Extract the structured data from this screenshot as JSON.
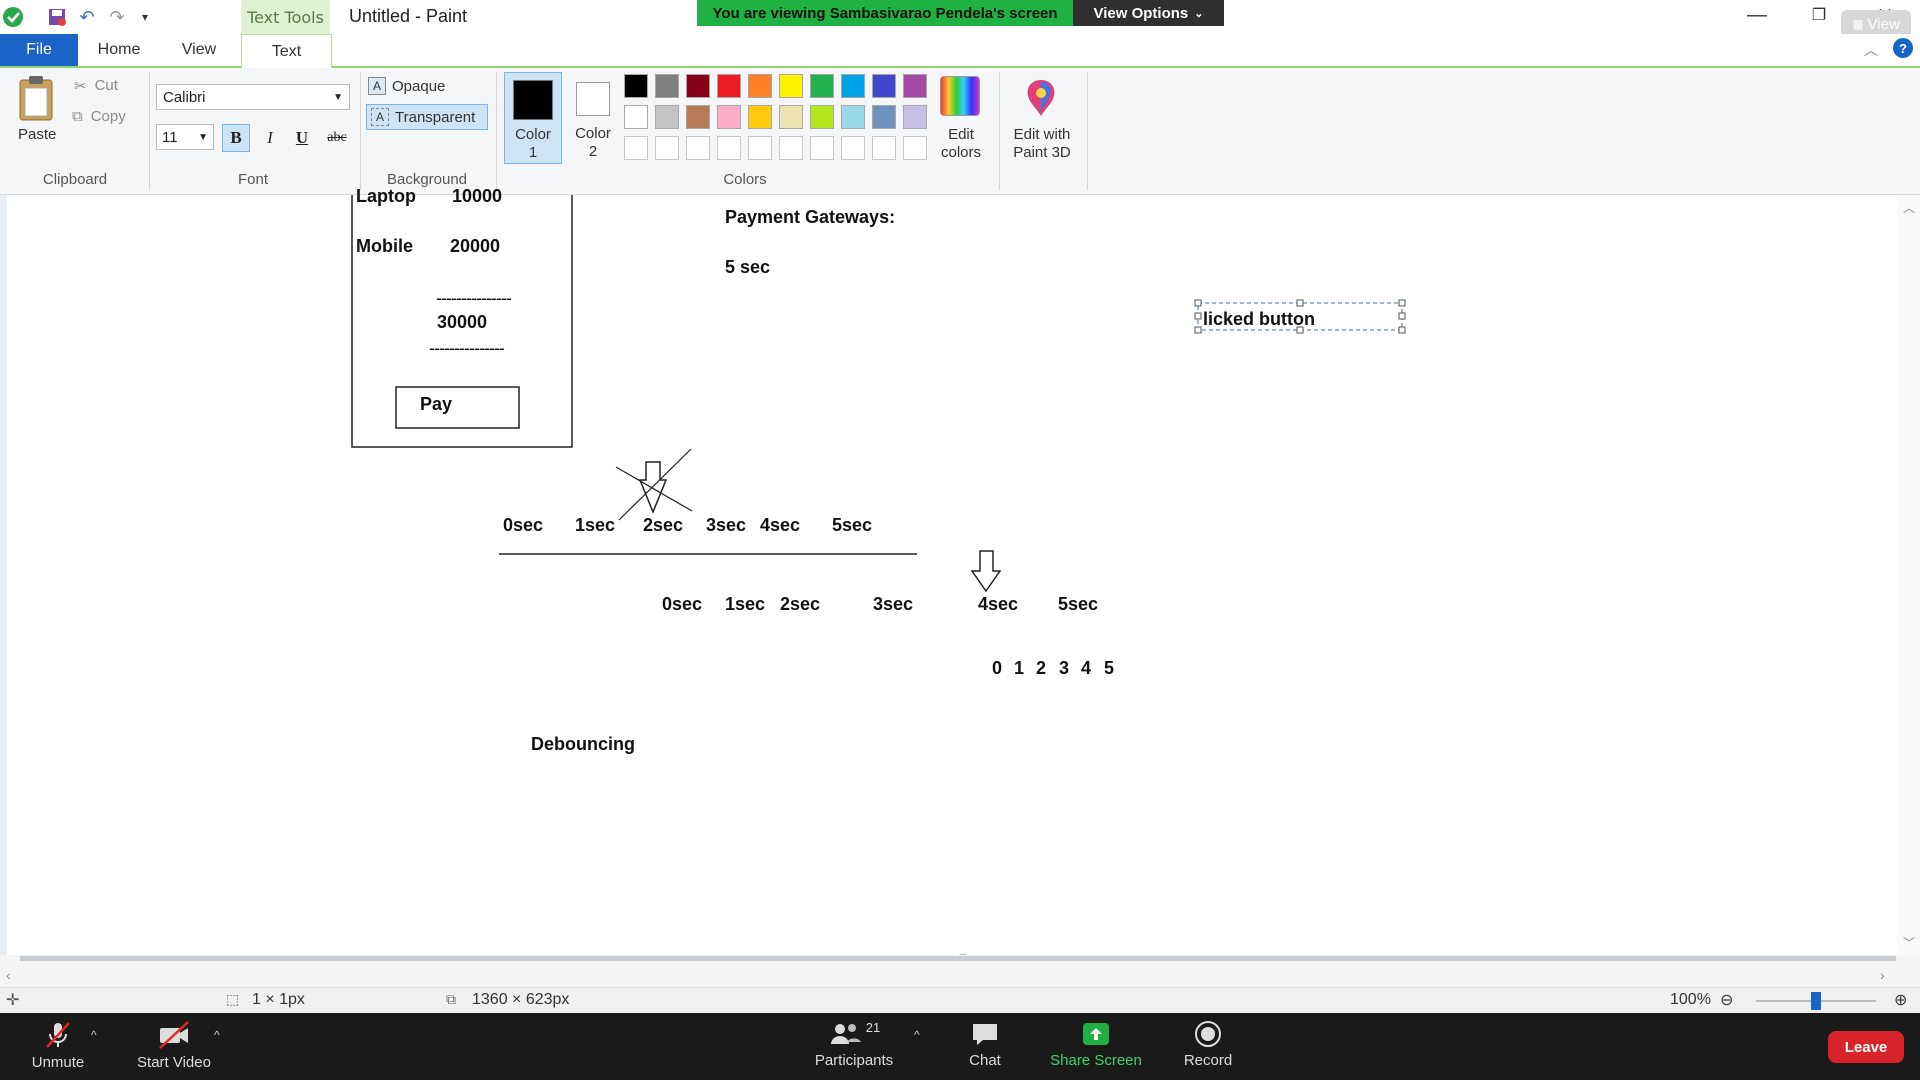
{
  "titlebar": {
    "context_tab": "Text Tools",
    "window_title": "Untitled - Paint",
    "share_banner": "You are viewing Sambasivarao Pendela's screen",
    "view_options": "View Options",
    "view_pill": "View"
  },
  "tabs": {
    "file": "File",
    "home": "Home",
    "view": "View",
    "text": "Text"
  },
  "ribbon": {
    "clipboard": {
      "paste": "Paste",
      "cut": "Cut",
      "copy": "Copy",
      "group": "Clipboard"
    },
    "font": {
      "family": "Calibri",
      "size": "11",
      "bold": "B",
      "italic": "I",
      "underline": "U",
      "strike": "abc",
      "group": "Font"
    },
    "background": {
      "opaque": "Opaque",
      "transparent": "Transparent",
      "group": "Background"
    },
    "colors": {
      "color1_label1": "Color",
      "color1_label2": "1",
      "color2_label1": "Color",
      "color2_label2": "2",
      "edit_colors_1": "Edit",
      "edit_colors_2": "colors",
      "edit_paint3d_1": "Edit with",
      "edit_paint3d_2": "Paint 3D",
      "group": "Colors",
      "color1": "#000000",
      "color2": "#ffffff",
      "row1": [
        "#000000",
        "#7f7f7f",
        "#880015",
        "#ed1c24",
        "#ff7f27",
        "#fff200",
        "#22b14c",
        "#00a2e8",
        "#3f48cc",
        "#a349a4"
      ],
      "row2": [
        "#ffffff",
        "#c3c3c3",
        "#b97a57",
        "#ffaec9",
        "#ffc90e",
        "#efe4b0",
        "#b5e61d",
        "#99d9ea",
        "#7092be",
        "#c8bfe7"
      ]
    }
  },
  "canvas": {
    "laptop_label": "Laptop",
    "laptop_value": "10000",
    "mobile_label": "Mobile",
    "mobile_value": "20000",
    "dash1": "---------------",
    "total": "30000",
    "dash2": "---------------",
    "pay_button": "Pay",
    "payment_gateways": "Payment Gateways:",
    "five_sec": "5 sec",
    "text_box": "licked button",
    "timeline1": [
      "0sec",
      "1sec",
      "2sec",
      "3sec",
      "4sec",
      "5sec"
    ],
    "timeline2": [
      "0sec",
      "1sec",
      "2sec",
      "3sec",
      "4sec",
      "5sec"
    ],
    "digits": [
      "0",
      "1",
      "2",
      "3",
      "4",
      "5"
    ],
    "debouncing": "Debouncing"
  },
  "statusbar": {
    "selection_size": "1 × 1px",
    "canvas_size": "1360 × 623px",
    "zoom": "100%"
  },
  "zoombar": {
    "unmute": "Unmute",
    "start_video": "Start Video",
    "participants": "Participants",
    "participants_count": "21",
    "chat": "Chat",
    "share_screen": "Share Screen",
    "record": "Record",
    "leave": "Leave"
  }
}
